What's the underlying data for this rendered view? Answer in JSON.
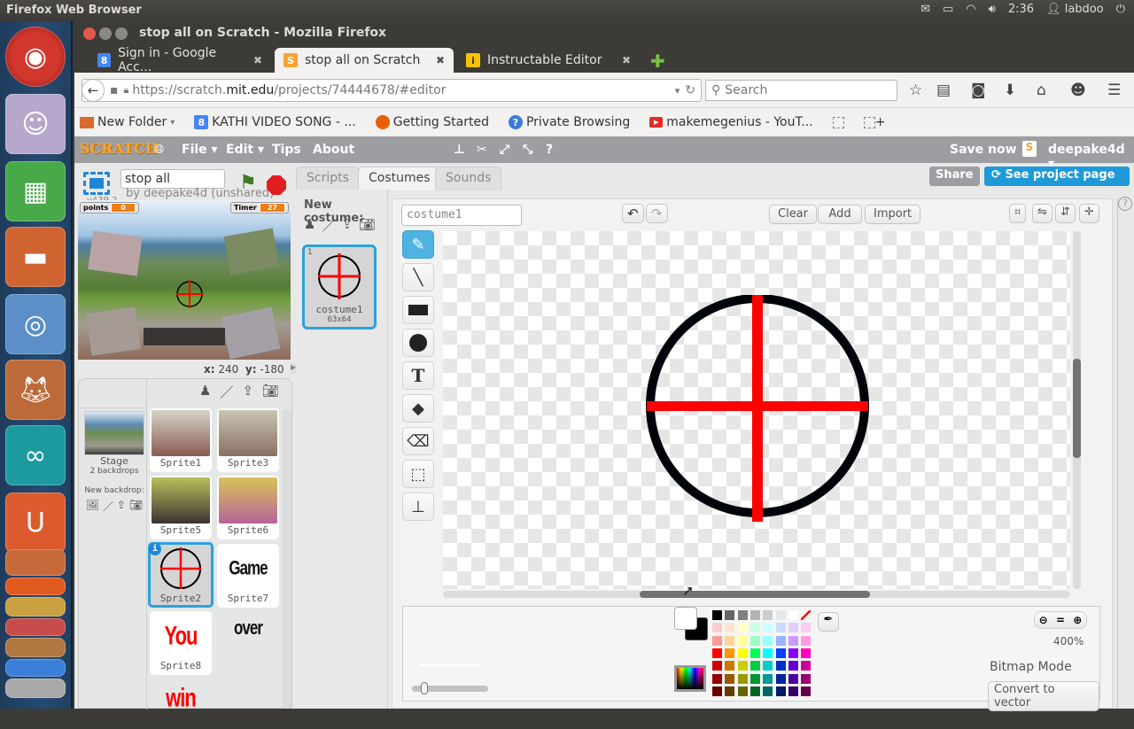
{
  "os": {
    "app_name": "Firefox Web Browser",
    "clock": "2:36",
    "user": "labdoo",
    "tray_icons": [
      "mail-icon",
      "battery-icon",
      "wifi-icon",
      "volume-icon"
    ]
  },
  "launcher": {
    "items": [
      "ubuntu-dash",
      "cheese-webcam",
      "libreoffice-calc",
      "files",
      "chromium",
      "firefox",
      "arduino",
      "ubuntu-one",
      "impress",
      "software-center",
      "terminal",
      "system-settings",
      "update-manager",
      "workspaces",
      "trash"
    ]
  },
  "browser": {
    "window_title": "stop all on Scratch - Mozilla Firefox",
    "tabs": [
      {
        "label": "Sign in - Google Acc...",
        "favicon": "8",
        "favicon_color": "#4285f4",
        "active": false
      },
      {
        "label": "stop all on Scratch",
        "favicon": "S",
        "favicon_color": "#f8a431",
        "active": true
      },
      {
        "label": "Instructable Editor",
        "favicon": "i",
        "favicon_color": "#f7c300",
        "active": false
      }
    ],
    "url_scheme": "https://scratch.",
    "url_domain": "mit.edu",
    "url_path": "/projects/74444678/#editor",
    "search_placeholder": "Search",
    "bookmarks": [
      {
        "label": "New Folder",
        "icon": "folder-icon",
        "dropdown": true
      },
      {
        "label": "KATHI VIDEO SONG - ...",
        "icon": "google-icon"
      },
      {
        "label": "Getting Started",
        "icon": "firefox-icon"
      },
      {
        "label": "Private Browsing",
        "icon": "help-icon"
      },
      {
        "label": "makemegenius - YouT...",
        "icon": "youtube-icon"
      }
    ]
  },
  "scratch": {
    "logo": "SCRATCH",
    "menu": {
      "file": "File",
      "edit": "Edit",
      "tips": "Tips",
      "about": "About"
    },
    "save_now": "Save now",
    "username": "deepake4d",
    "share_label": "Share",
    "see_project_label": "See project page",
    "project_title": "stop all",
    "version": "v439.2",
    "author_line": "by deepake4d (unshared)",
    "stage_monitors": {
      "points_label": "points",
      "points_value": "0",
      "timer_label": "Timer",
      "timer_value": "27"
    },
    "mouse_x_label": "x:",
    "mouse_x": "240",
    "mouse_y_label": "y:",
    "mouse_y": "-180",
    "tabs": [
      "Scripts",
      "Costumes",
      "Sounds"
    ],
    "active_tab": "Costumes",
    "new_costume_label": "New costume:",
    "costumes": [
      {
        "index": "1",
        "name": "costume1",
        "size": "63x64"
      }
    ],
    "stage_info": {
      "name": "Stage",
      "backdrops": "2 backdrops",
      "new_backdrop_label": "New backdrop:"
    },
    "sprites": [
      {
        "name": "Sprite1"
      },
      {
        "name": "Sprite3"
      },
      {
        "name": "Sprite5"
      },
      {
        "name": "Sprite6"
      },
      {
        "name": "Sprite2",
        "selected": true
      },
      {
        "name": "Sprite7",
        "thumb_text": "Game over"
      },
      {
        "name": "Sprite8",
        "thumb_text": "You win"
      }
    ],
    "paint": {
      "costume_name": "costume1",
      "clear_label": "Clear",
      "add_label": "Add",
      "import_label": "Import",
      "zoom_level": "400%",
      "mode_label": "Bitmap Mode",
      "convert_label": "Convert to vector",
      "tools": [
        "brush",
        "line",
        "rectangle",
        "ellipse",
        "text",
        "fill",
        "eraser",
        "select",
        "stamp"
      ],
      "active_tool": "brush",
      "palette": [
        [
          "#000000",
          "#666666",
          "#808080",
          "#b3b3b3",
          "#cccccc",
          "#e6e6e6",
          "#ffffff",
          "transparent"
        ],
        [
          "#ffcccc",
          "#ffe5cc",
          "#ffffcc",
          "#ccffe5",
          "#ccffff",
          "#ccdaff",
          "#e5ccff",
          "#ffccf2"
        ],
        [
          "#ff9999",
          "#ffd699",
          "#ffff99",
          "#99ffc2",
          "#99ffff",
          "#99b3ff",
          "#cc99ff",
          "#ff99e5"
        ],
        [
          "#ff0000",
          "#ff9500",
          "#ffff00",
          "#00ff55",
          "#00ffff",
          "#0040ff",
          "#8800ff",
          "#ff00bf"
        ],
        [
          "#cc0000",
          "#cc7700",
          "#cccc00",
          "#00cc44",
          "#00cccc",
          "#0033cc",
          "#6600cc",
          "#cc0099"
        ],
        [
          "#990000",
          "#995900",
          "#999900",
          "#009933",
          "#009999",
          "#002699",
          "#4d0099",
          "#990073"
        ],
        [
          "#660000",
          "#663b00",
          "#666600",
          "#006622",
          "#006666",
          "#001a66",
          "#330066",
          "#66004d"
        ]
      ],
      "primary_color": "#ffffff",
      "secondary_color": "#000000"
    }
  }
}
